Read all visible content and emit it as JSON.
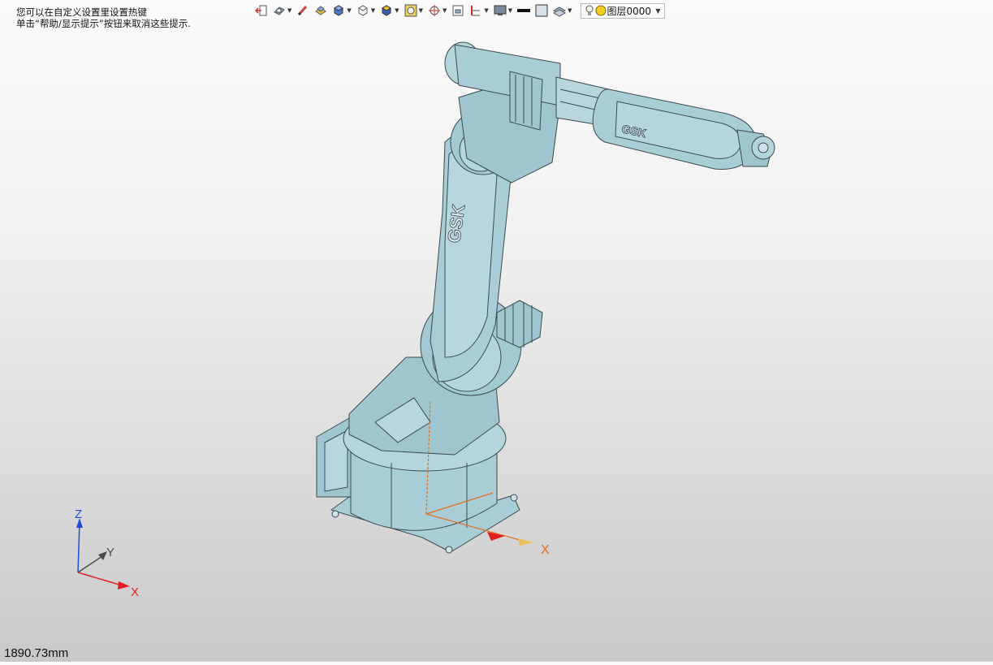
{
  "hint": {
    "line1": "您可以在自定义设置里设置热键",
    "line2": "单击“帮助/显示提示”按钮来取消这些提示."
  },
  "toolbar": {
    "buttons": [
      {
        "name": "exit-icon",
        "dropdown": false
      },
      {
        "name": "view-orient-icon",
        "dropdown": true
      },
      {
        "name": "pen-icon",
        "dropdown": false
      },
      {
        "name": "render-style-icon",
        "dropdown": false
      },
      {
        "name": "shaded-cube-icon",
        "dropdown": true
      },
      {
        "name": "wireframe-cube-icon",
        "dropdown": true
      },
      {
        "name": "iso-cube-icon",
        "dropdown": true
      },
      {
        "name": "zoom-fit-icon",
        "dropdown": true
      },
      {
        "name": "target-icon",
        "dropdown": true
      },
      {
        "name": "fit-box-icon",
        "dropdown": false
      },
      {
        "name": "measure-icon",
        "dropdown": true
      },
      {
        "name": "monitor-icon",
        "dropdown": true
      },
      {
        "name": "line-style-icon",
        "dropdown": false
      },
      {
        "name": "fill-color-icon",
        "dropdown": false
      },
      {
        "name": "layer-stack-icon",
        "dropdown": true
      }
    ],
    "layer_select": {
      "value": "图层0000"
    }
  },
  "model": {
    "logo_arm": "GSK",
    "logo_forearm": "GSK"
  },
  "triad": {
    "x": "X",
    "y": "Y",
    "z": "Z"
  },
  "model_triad": {
    "x": "X"
  },
  "status": {
    "distance": "1890.73mm"
  },
  "colors": {
    "model": "#a9cdd6",
    "model_shade": "#8fb7c2",
    "edge": "#3b4a50",
    "axis_x": "#e02020",
    "axis_y": "#4a4a4a",
    "axis_z": "#1f4fd8",
    "axis_orange": "#e07020"
  }
}
